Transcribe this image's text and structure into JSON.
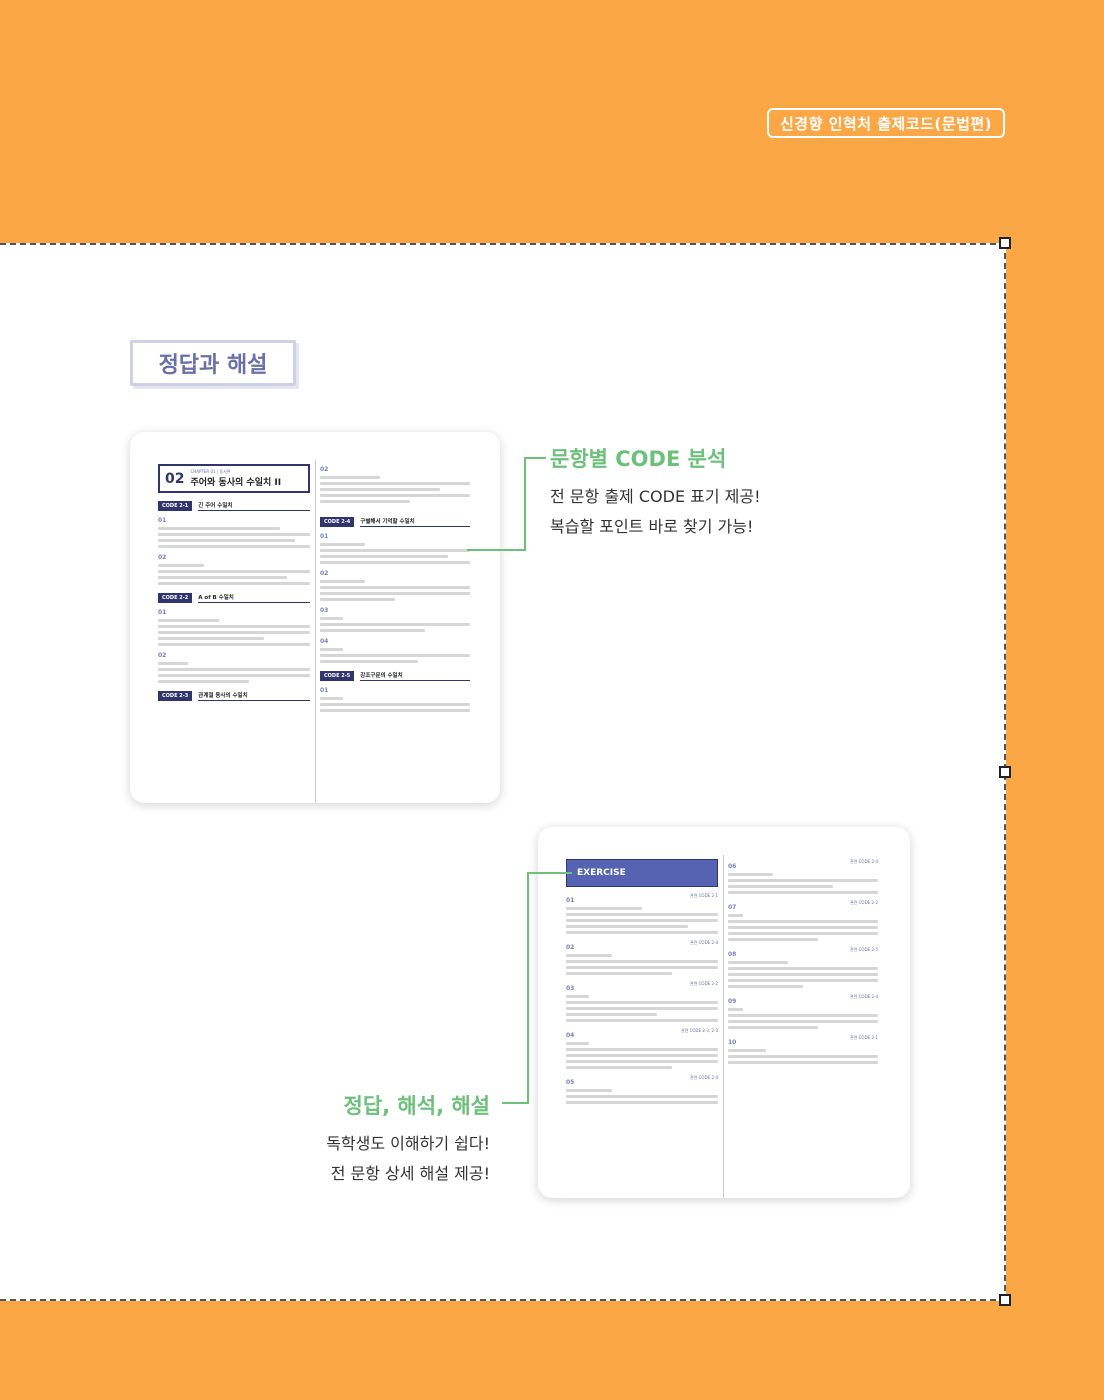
{
  "header": {
    "badge": "신경향 인혁처 출제코드(문법편)"
  },
  "section_title": "정답과 해설",
  "thumb1": {
    "chapter_label": "CHAPTER 01 | 동사편",
    "chapter_num": "02",
    "chapter_title": "주어와 동사의 수일치 II",
    "left": {
      "codes": [
        {
          "tag": "CODE 2-1",
          "title": "긴 주어 수일치"
        },
        {
          "tag": "CODE 2-2",
          "title": "A of B 수일치"
        },
        {
          "tag": "CODE 2-3",
          "title": "관계절 동사의 수일치"
        }
      ],
      "items": [
        "01",
        "02",
        "01",
        "02"
      ]
    },
    "right": {
      "codes": [
        {
          "tag": "CODE 2-4",
          "title": "구별해서 기억할 수일치"
        },
        {
          "tag": "CODE 2-5",
          "title": "강조구문의 수일치"
        }
      ],
      "items": [
        "02",
        "01",
        "02",
        "03",
        "04",
        "01"
      ]
    }
  },
  "thumb2": {
    "exercise_label": "EXERCISE",
    "left": {
      "items": [
        {
          "num": "01",
          "ref": "관련 CODE 2-1"
        },
        {
          "num": "02",
          "ref": "관련 CODE 2-4"
        },
        {
          "num": "03",
          "ref": "관련 CODE 2-2"
        },
        {
          "num": "04",
          "ref": "관련 CODE 2-3, 2-3"
        },
        {
          "num": "05",
          "ref": "관련 CODE 2-4"
        }
      ]
    },
    "right": {
      "items": [
        {
          "num": "06",
          "ref": "관련 CODE 2-4"
        },
        {
          "num": "07",
          "ref": "관련 CODE 2-2"
        },
        {
          "num": "08",
          "ref": "관련 CODE 2-5"
        },
        {
          "num": "09",
          "ref": "관련 CODE 2-4"
        },
        {
          "num": "10",
          "ref": "관련 CODE 2-1"
        }
      ]
    }
  },
  "callout1": {
    "title": "문항별 CODE 분석",
    "line1": "전 문항 출제 CODE 표기 제공!",
    "line2": "복습할 포인트 바로 찾기 가능!"
  },
  "callout2": {
    "title": "정답, 해석, 해설",
    "line1": "독학생도 이해하기 쉽다!",
    "line2": "전 문항 상세 해설 제공!"
  },
  "colors": {
    "background": "#fba746",
    "accent_green": "#6cc07a",
    "navy": "#31356e",
    "exercise_blue": "#5563b2"
  }
}
